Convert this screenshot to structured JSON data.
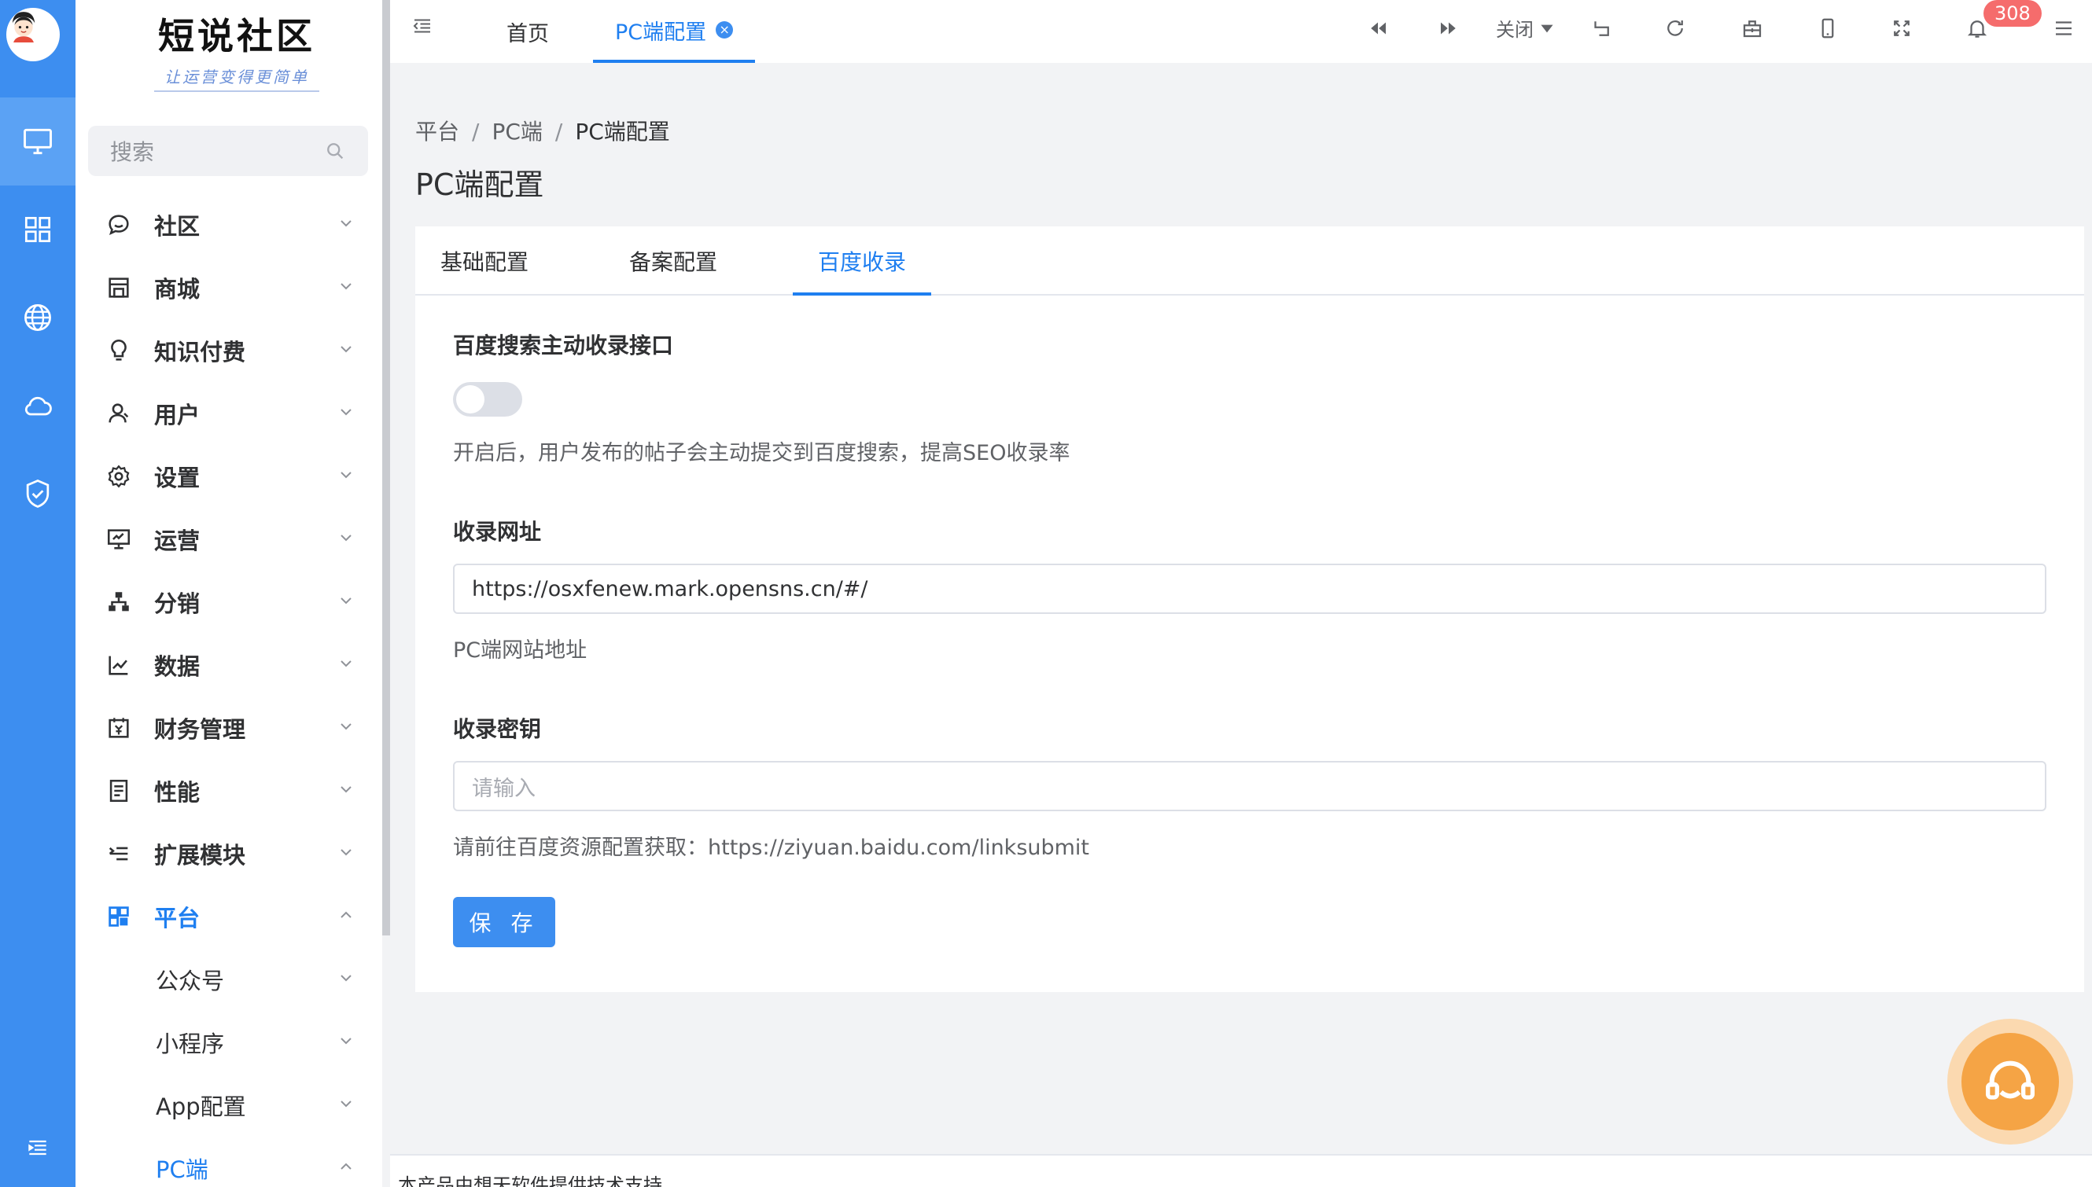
{
  "app": {
    "logo_title": "短说社区",
    "logo_slogan": "让运营变得更简单"
  },
  "sidebar": {
    "search_placeholder": "搜索",
    "menu": [
      {
        "label": "社区",
        "icon": "chat-icon"
      },
      {
        "label": "商城",
        "icon": "store-icon"
      },
      {
        "label": "知识付费",
        "icon": "bulb-icon"
      },
      {
        "label": "用户",
        "icon": "user-icon"
      },
      {
        "label": "设置",
        "icon": "gear-icon"
      },
      {
        "label": "运营",
        "icon": "presentation-icon"
      },
      {
        "label": "分销",
        "icon": "hierarchy-icon"
      },
      {
        "label": "数据",
        "icon": "line-chart-icon"
      },
      {
        "label": "财务管理",
        "icon": "finance-icon"
      },
      {
        "label": "性能",
        "icon": "report-icon"
      },
      {
        "label": "扩展模块",
        "icon": "extension-icon"
      },
      {
        "label": "平台",
        "icon": "platform-icon"
      }
    ],
    "submenu": [
      {
        "label": "公众号"
      },
      {
        "label": "小程序"
      },
      {
        "label": "App配置"
      },
      {
        "label": "PC端"
      }
    ]
  },
  "topbar": {
    "tabs": [
      {
        "label": "首页"
      },
      {
        "label": "PC端配置"
      }
    ],
    "close_label": "关闭",
    "notification_count": "308"
  },
  "breadcrumb": {
    "items": [
      "平台",
      "PC端",
      "PC端配置"
    ]
  },
  "page": {
    "title": "PC端配置",
    "tabs": [
      {
        "label": "基础配置"
      },
      {
        "label": "备案配置"
      },
      {
        "label": "百度收录"
      }
    ]
  },
  "form": {
    "push_label": "百度搜索主动收录接口",
    "push_enabled": false,
    "push_help": "开启后，用户发布的帖子会主动提交到百度搜索，提高SEO收录率",
    "url_label": "收录网址",
    "url_value": "https://osxfenew.mark.opensns.cn/#/",
    "url_help": "PC端网站地址",
    "key_label": "收录密钥",
    "key_placeholder": "请输入",
    "key_help": "请前往百度资源配置获取：https://ziyuan.baidu.com/linksubmit",
    "save_label": "保 存"
  },
  "footer": {
    "text": "本产品由想天软件提供技术支持"
  },
  "colors": {
    "primary": "#1f7ff0",
    "rail": "#3d8ef0",
    "badge": "#f56c6c",
    "service": "#f5a445"
  }
}
